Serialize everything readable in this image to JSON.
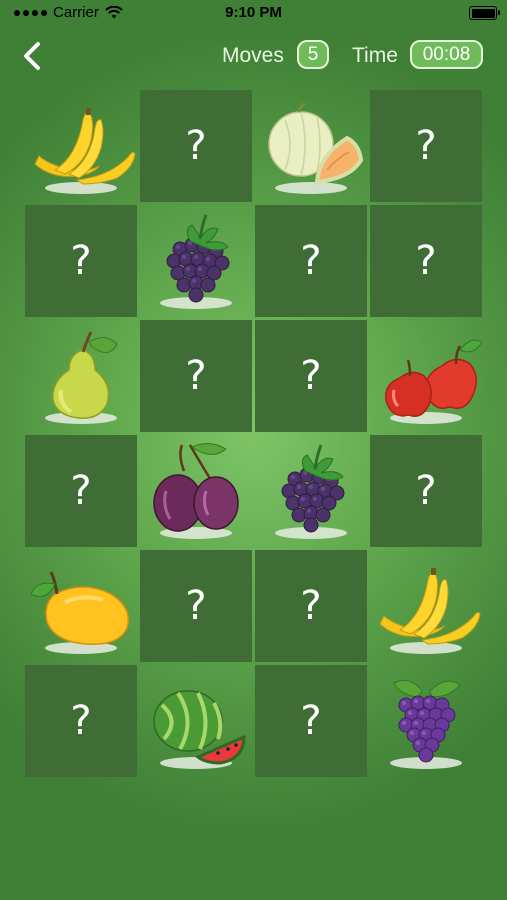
{
  "status_bar": {
    "carrier": "Carrier",
    "time": "9:10 PM"
  },
  "header": {
    "moves_label": "Moves",
    "moves_value": "5",
    "time_label": "Time",
    "time_value": "00:08"
  },
  "hidden_card_symbol": "?",
  "board": [
    [
      "banana",
      "hidden",
      "melon",
      "hidden"
    ],
    [
      "hidden",
      "blackberry",
      "hidden",
      "hidden"
    ],
    [
      "pear",
      "hidden",
      "hidden",
      "apple"
    ],
    [
      "hidden",
      "plum",
      "blackberry",
      "hidden"
    ],
    [
      "mango",
      "hidden",
      "hidden",
      "banana"
    ],
    [
      "hidden",
      "watermelon",
      "hidden",
      "grape"
    ]
  ]
}
